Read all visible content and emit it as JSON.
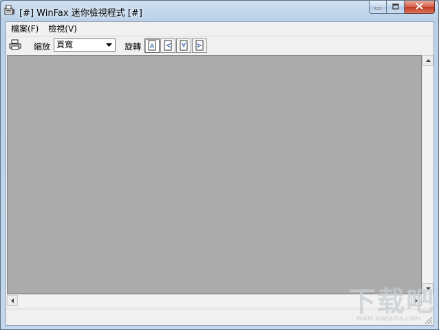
{
  "window": {
    "title": "[#] WinFax 迷你檢視程式 [#]"
  },
  "menu": {
    "items": [
      {
        "label": "檔案(F)"
      },
      {
        "label": "檢視(V)"
      }
    ]
  },
  "toolbar": {
    "zoom_label": "縮放",
    "zoom_value": "頁寬",
    "rotate_label": "旋轉",
    "rotate_buttons": [
      {
        "glyph": "A"
      },
      {
        "glyph": "A"
      },
      {
        "glyph": "A"
      },
      {
        "glyph": "A"
      }
    ]
  },
  "watermark": {
    "big": "下载吧",
    "small": "www.xiazaiba.com"
  },
  "icons": {
    "app": "fax-app-icon",
    "print": "printer-icon",
    "minimize": "minimize-icon",
    "maximize": "maximize-icon",
    "close": "close-icon",
    "dropdown": "chevron-down-icon",
    "rotate": [
      "rotate-0-icon",
      "rotate-90-left-icon",
      "rotate-180-icon",
      "rotate-90-right-icon"
    ]
  }
}
